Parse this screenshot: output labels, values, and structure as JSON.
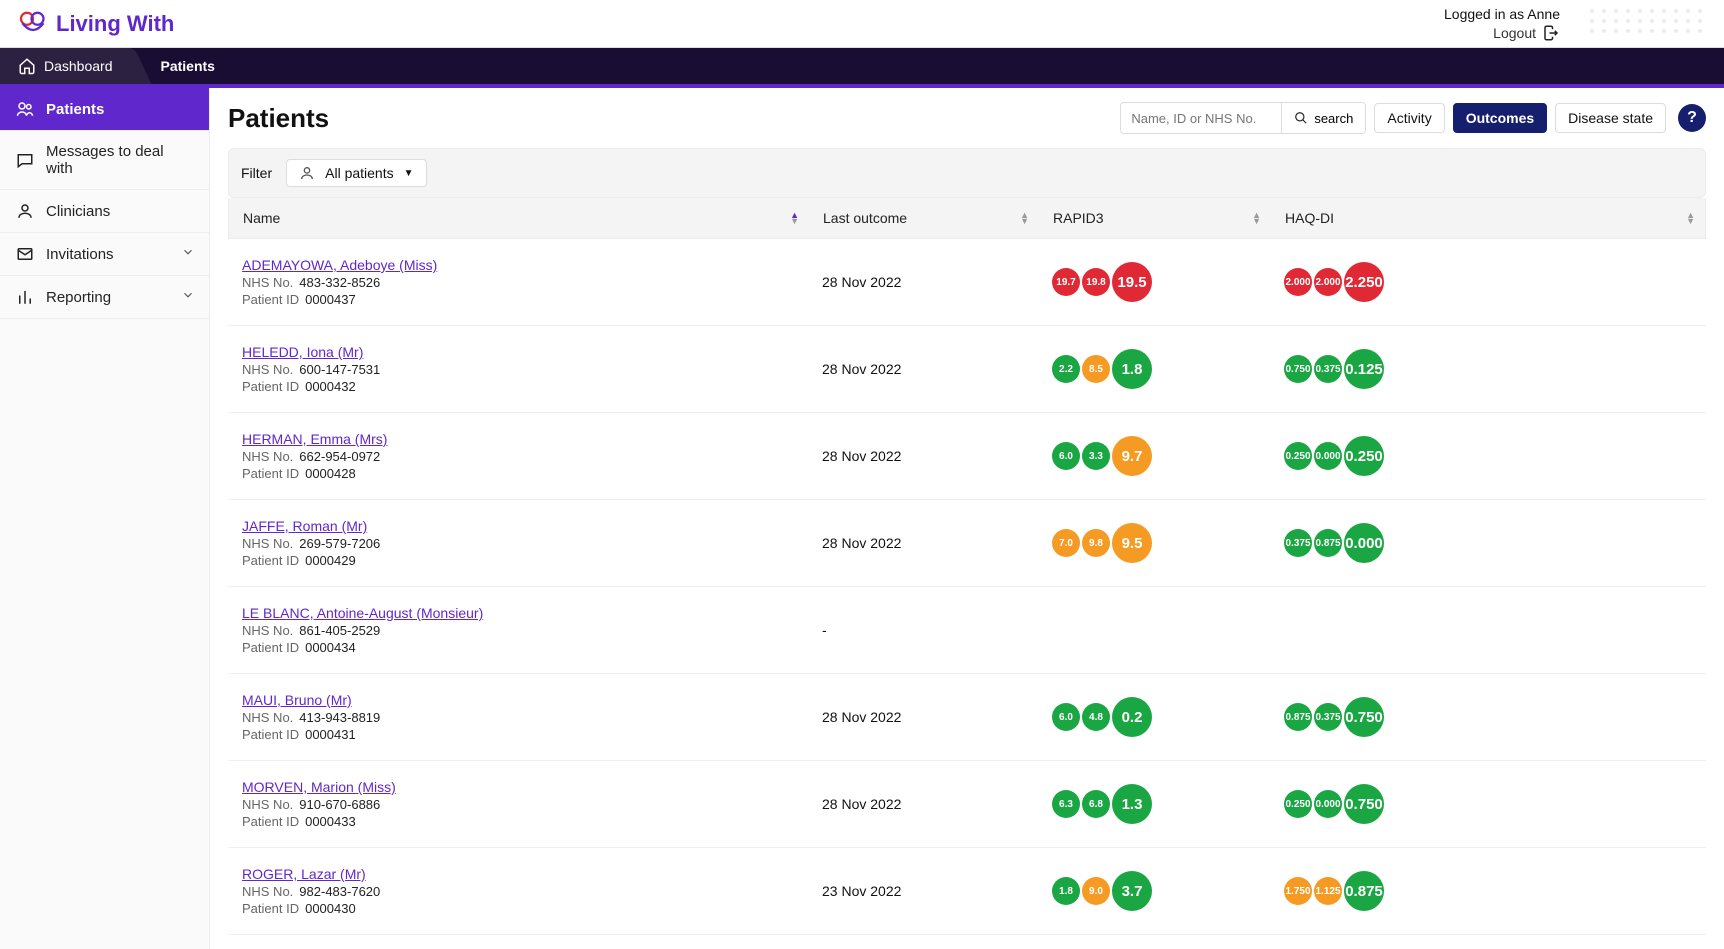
{
  "brand": {
    "name": "Living With"
  },
  "user": {
    "logged_in_text": "Logged in as Anne",
    "logout_label": "Logout"
  },
  "main_nav": {
    "dashboard": "Dashboard",
    "patients": "Patients"
  },
  "sidebar": {
    "items": [
      {
        "label": "Patients"
      },
      {
        "label": "Messages to deal with"
      },
      {
        "label": "Clinicians"
      },
      {
        "label": "Invitations"
      },
      {
        "label": "Reporting"
      }
    ]
  },
  "page": {
    "title": "Patients"
  },
  "search": {
    "placeholder": "Name, ID or NHS No.",
    "button": "search"
  },
  "view_tabs": {
    "activity": "Activity",
    "outcomes": "Outcomes",
    "disease": "Disease state"
  },
  "help": "?",
  "filter": {
    "label": "Filter",
    "chip": "All patients"
  },
  "columns": {
    "name": "Name",
    "last": "Last outcome",
    "rapid": "RAPID3",
    "haq": "HAQ-DI"
  },
  "labels": {
    "nhs": "NHS No.",
    "pid": "Patient ID"
  },
  "rows": [
    {
      "name": "ADEMAYOWA, Adeboye (Miss)",
      "nhs": "483-332-8526",
      "pid": "0000437",
      "last": "28 Nov 2022",
      "rapid": [
        {
          "v": "19.7",
          "c": "red"
        },
        {
          "v": "19.8",
          "c": "red"
        },
        {
          "v": "19.5",
          "c": "red",
          "big": true
        }
      ],
      "haq": [
        {
          "v": "2.000",
          "c": "red"
        },
        {
          "v": "2.000",
          "c": "red"
        },
        {
          "v": "2.250",
          "c": "red",
          "big": true
        }
      ]
    },
    {
      "name": "HELEDD, Iona (Mr)",
      "nhs": "600-147-7531",
      "pid": "0000432",
      "last": "28 Nov 2022",
      "rapid": [
        {
          "v": "2.2",
          "c": "green"
        },
        {
          "v": "8.5",
          "c": "orange"
        },
        {
          "v": "1.8",
          "c": "green",
          "big": true
        }
      ],
      "haq": [
        {
          "v": "0.750",
          "c": "green"
        },
        {
          "v": "0.375",
          "c": "green"
        },
        {
          "v": "0.125",
          "c": "green",
          "big": true
        }
      ]
    },
    {
      "name": "HERMAN, Emma (Mrs)",
      "nhs": "662-954-0972",
      "pid": "0000428",
      "last": "28 Nov 2022",
      "rapid": [
        {
          "v": "6.0",
          "c": "green"
        },
        {
          "v": "3.3",
          "c": "green"
        },
        {
          "v": "9.7",
          "c": "orange",
          "big": true
        }
      ],
      "haq": [
        {
          "v": "0.250",
          "c": "green"
        },
        {
          "v": "0.000",
          "c": "green"
        },
        {
          "v": "0.250",
          "c": "green",
          "big": true
        }
      ]
    },
    {
      "name": "JAFFE, Roman (Mr)",
      "nhs": "269-579-7206",
      "pid": "0000429",
      "last": "28 Nov 2022",
      "rapid": [
        {
          "v": "7.0",
          "c": "orange"
        },
        {
          "v": "9.8",
          "c": "orange"
        },
        {
          "v": "9.5",
          "c": "orange",
          "big": true
        }
      ],
      "haq": [
        {
          "v": "0.375",
          "c": "green"
        },
        {
          "v": "0.875",
          "c": "green"
        },
        {
          "v": "0.000",
          "c": "green",
          "big": true
        }
      ]
    },
    {
      "name": "LE BLANC, Antoine-August (Monsieur)",
      "nhs": "861-405-2529",
      "pid": "0000434",
      "last": "-",
      "rapid": [],
      "haq": []
    },
    {
      "name": "MAUI, Bruno (Mr)",
      "nhs": "413-943-8819",
      "pid": "0000431",
      "last": "28 Nov 2022",
      "rapid": [
        {
          "v": "6.0",
          "c": "green"
        },
        {
          "v": "4.8",
          "c": "green"
        },
        {
          "v": "0.2",
          "c": "green",
          "big": true
        }
      ],
      "haq": [
        {
          "v": "0.875",
          "c": "green"
        },
        {
          "v": "0.375",
          "c": "green"
        },
        {
          "v": "0.750",
          "c": "green",
          "big": true
        }
      ]
    },
    {
      "name": "MORVEN, Marion (Miss)",
      "nhs": "910-670-6886",
      "pid": "0000433",
      "last": "28 Nov 2022",
      "rapid": [
        {
          "v": "6.3",
          "c": "green"
        },
        {
          "v": "6.8",
          "c": "green"
        },
        {
          "v": "1.3",
          "c": "green",
          "big": true
        }
      ],
      "haq": [
        {
          "v": "0.250",
          "c": "green"
        },
        {
          "v": "0.000",
          "c": "green"
        },
        {
          "v": "0.750",
          "c": "green",
          "big": true
        }
      ]
    },
    {
      "name": "ROGER, Lazar (Mr)",
      "nhs": "982-483-7620",
      "pid": "0000430",
      "last": "23 Nov 2022",
      "rapid": [
        {
          "v": "1.8",
          "c": "green"
        },
        {
          "v": "9.0",
          "c": "orange"
        },
        {
          "v": "3.7",
          "c": "green",
          "big": true
        }
      ],
      "haq": [
        {
          "v": "1.750",
          "c": "orange"
        },
        {
          "v": "1.125",
          "c": "orange"
        },
        {
          "v": "0.875",
          "c": "green",
          "big": true
        }
      ]
    }
  ]
}
